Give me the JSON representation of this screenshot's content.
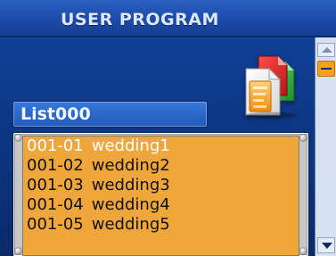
{
  "header": {
    "title": "USER PROGRAM"
  },
  "list_field": {
    "name": "List000"
  },
  "programs": [
    {
      "number": "001-01",
      "name": "wedding1",
      "selected": true
    },
    {
      "number": "001-02",
      "name": "wedding2",
      "selected": false
    },
    {
      "number": "001-03",
      "name": "wedding3",
      "selected": false
    },
    {
      "number": "001-04",
      "name": "wedding4",
      "selected": false
    },
    {
      "number": "001-05",
      "name": "wedding5",
      "selected": false
    }
  ],
  "icons": {
    "document": "documents-copy-icon",
    "scroll_up": "scroll-up-icon",
    "scroll_down": "scroll-down-icon"
  },
  "colors": {
    "title_bar": "#1c4aa7",
    "list_background": "#efa63a",
    "selected_text": "#ffffff",
    "scroll_thumb": "#f5a21a"
  }
}
